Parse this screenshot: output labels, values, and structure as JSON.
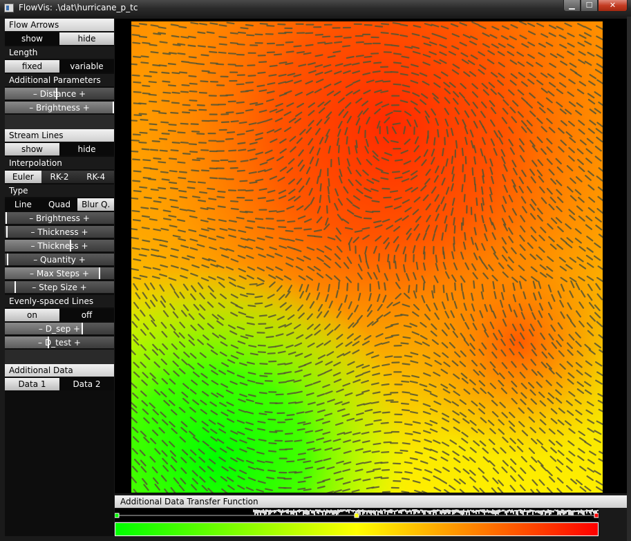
{
  "window": {
    "title": "FlowVis: .\\dat\\hurricane_p_tc",
    "min": "▁",
    "max": "☐",
    "close": "✕"
  },
  "flow_arrows": {
    "header": "Flow Arrows",
    "show": "show",
    "hide": "hide",
    "length_label": "Length",
    "fixed": "fixed",
    "variable": "variable",
    "params_label": "Additional Parameters",
    "distance": "– Distance +",
    "brightness": "– Brightness +"
  },
  "stream_lines": {
    "header": "Stream Lines",
    "show": "show",
    "hide": "hide",
    "interp_label": "Interpolation",
    "euler": "Euler",
    "rk2": "RK-2",
    "rk4": "RK-4",
    "type_label": "Type",
    "line": "Line",
    "quad": "Quad",
    "blur": "Blur Q.",
    "brightness": "– Brightness +",
    "thickness1": "– Thickness +",
    "thickness2": "– Thickness +",
    "quantity": "– Quantity +",
    "max_steps": "– Max Steps +",
    "step_size": "– Step Size +",
    "evenly_label": "Evenly-spaced Lines",
    "on": "on",
    "off": "off",
    "dsep": "– D_sep +",
    "dtest": "– D_test +"
  },
  "additional_data": {
    "header": "Additional Data",
    "data1": "Data 1",
    "data2": "Data 2"
  },
  "transfer_function": {
    "header": "Additional Data Transfer Function",
    "gradient_colors": [
      "#00ff00",
      "#ffff00",
      "#ff0000"
    ],
    "control_points": [
      {
        "position": 0.0,
        "color": "#00ff00"
      },
      {
        "position": 0.5,
        "color": "#ffff00"
      },
      {
        "position": 1.0,
        "color": "#ff0000"
      }
    ]
  },
  "colors": {
    "low": "#00ff00",
    "mid": "#ffff00",
    "high": "#ff0000",
    "stroke": "#555533"
  }
}
